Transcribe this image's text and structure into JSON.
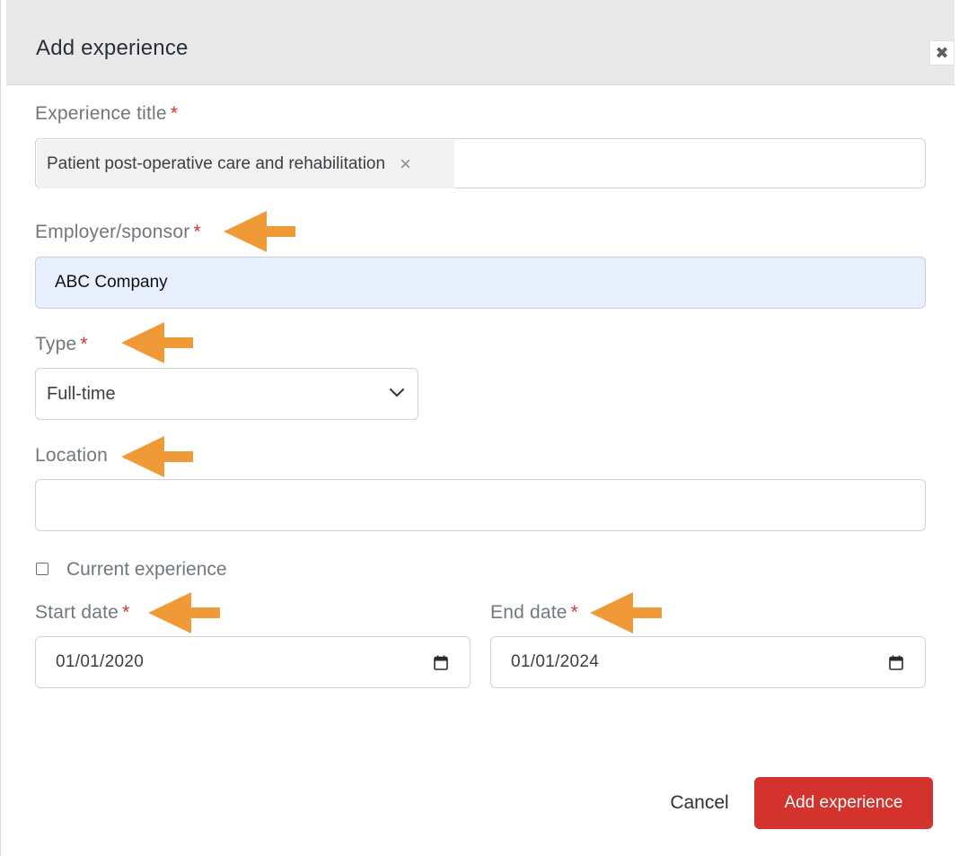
{
  "modal": {
    "title": "Add experience",
    "close_symbol": "✖"
  },
  "fields": {
    "experience_title": {
      "label": "Experience title",
      "required_mark": "*",
      "chip_value": "Patient post-operative care and rehabilitation",
      "chip_remove": "×"
    },
    "employer": {
      "label": "Employer/sponsor",
      "required_mark": "*",
      "value": "ABC Company"
    },
    "type": {
      "label": "Type",
      "required_mark": "*",
      "value": "Full-time"
    },
    "location": {
      "label": "Location",
      "value": ""
    },
    "current_experience": {
      "label": "Current experience",
      "checked": false
    },
    "start_date": {
      "label": "Start date",
      "required_mark": "*",
      "value": "01/01/2020"
    },
    "end_date": {
      "label": "End date",
      "required_mark": "*",
      "value": "01/01/2024"
    }
  },
  "actions": {
    "cancel_label": "Cancel",
    "submit_label": "Add experience"
  },
  "colors": {
    "accent": "#d3322d",
    "annotation_arrow": "#f09a37",
    "header_bg": "#e9e9e9",
    "autofill_bg": "#e8effd"
  },
  "icons": [
    "close-icon",
    "chip-remove-icon",
    "chevron-down-icon",
    "calendar-icon",
    "arrow-left-icon"
  ]
}
